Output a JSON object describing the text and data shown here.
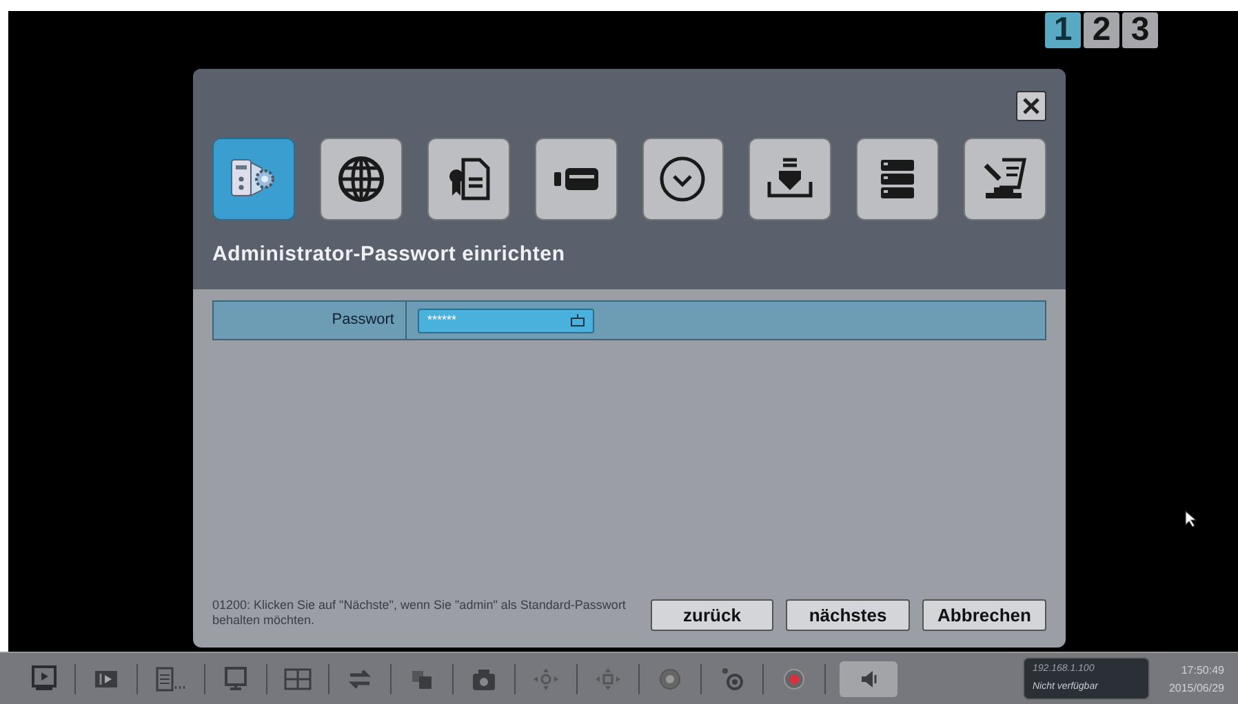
{
  "pages": [
    {
      "label": "1",
      "selected": true
    },
    {
      "label": "2",
      "selected": false
    },
    {
      "label": "3",
      "selected": false
    }
  ],
  "dialog": {
    "categories": [
      {
        "kind": "system",
        "selected": true
      },
      {
        "kind": "network",
        "selected": false
      },
      {
        "kind": "certificate",
        "selected": false
      },
      {
        "kind": "camera",
        "selected": false
      },
      {
        "kind": "clock",
        "selected": false
      },
      {
        "kind": "install",
        "selected": false
      },
      {
        "kind": "storage",
        "selected": false
      },
      {
        "kind": "tools",
        "selected": false
      }
    ],
    "title": "Administrator-Passwort einrichten",
    "field": {
      "label": "Passwort",
      "value": "******"
    },
    "hint": "01200: Klicken Sie auf \"Nächste\", wenn Sie \"admin\" als Standard-Passwort behalten möchten.",
    "buttons": [
      "zurück",
      "nächstes",
      "Abbrechen"
    ]
  },
  "taskbar": {
    "tools": [
      {
        "kind": "playback"
      },
      {
        "kind": "step"
      },
      {
        "kind": "list"
      },
      {
        "kind": "monitor"
      },
      {
        "kind": "grid"
      },
      {
        "kind": "swap"
      },
      {
        "kind": "layers"
      },
      {
        "kind": "camera"
      },
      {
        "kind": "ptz"
      },
      {
        "kind": "ptz2"
      },
      {
        "kind": "target"
      },
      {
        "kind": "focus"
      },
      {
        "kind": "record"
      },
      {
        "kind": "audio"
      }
    ],
    "ip": "192.168.1.100",
    "status": "Nicht verfügbar",
    "time": "17:50:49",
    "date": "2015/06/29"
  }
}
